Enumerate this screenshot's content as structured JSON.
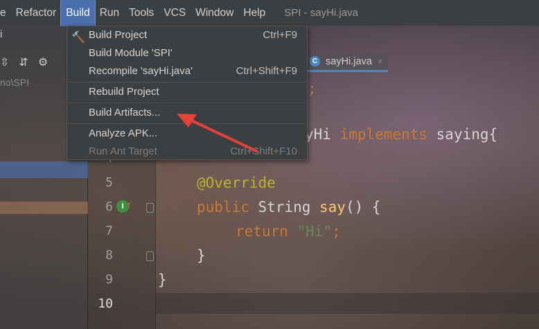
{
  "menubar": {
    "items": [
      "e",
      "Refactor",
      "Build",
      "Run",
      "Tools",
      "VCS",
      "Window",
      "Help"
    ],
    "window_title": "SPI - sayHi.java"
  },
  "left_panel": {
    "label": "i",
    "path": "no\\SPI",
    "toolbar_icons": [
      "expand-all-icon",
      "collapse-all-icon",
      "gear-icon"
    ]
  },
  "tab": {
    "label": "sayHi.java",
    "close": "×"
  },
  "build_menu": {
    "items": [
      {
        "label": "Build Project",
        "shortcut": "Ctrl+F9",
        "enabled": true
      },
      {
        "label": "Build Module 'SPI'",
        "shortcut": "",
        "enabled": true
      },
      {
        "label": "Recompile 'sayHi.java'",
        "shortcut": "Ctrl+Shift+F9",
        "enabled": true
      },
      {
        "label": "Rebuild Project",
        "shortcut": "",
        "enabled": true
      },
      {
        "label": "Build Artifacts...",
        "shortcut": "",
        "enabled": true
      },
      {
        "label": "Analyze APK...",
        "shortcut": "",
        "enabled": true
      },
      {
        "label": "Run Ant Target",
        "shortcut": "Ctrl+Shift+F10",
        "enabled": false
      }
    ]
  },
  "editor": {
    "line_numbers": [
      "4",
      "5",
      "6",
      "7",
      "8",
      "9",
      "10"
    ],
    "code": {
      "line1_tail": ";",
      "line3_part1": "yHi ",
      "line3_kw": "implements",
      "line3_part2": " saying{",
      "line5_ann": "@Override",
      "line6_kw": "public",
      "line6_type": " String ",
      "line6_fn": "say",
      "line6_rest": "() {",
      "line7_kw": "return",
      "line7_str": "\"Hi\"",
      "line7_end": ";",
      "line8": "}",
      "line9": "}"
    },
    "gutter_badge": "I"
  },
  "colors": {
    "menu_active": "#4b6eaf",
    "keyword": "#cc7832",
    "annotation": "#bbb529",
    "string": "#6a8759",
    "function": "#ffc66d",
    "arrow": "#e8413a"
  }
}
